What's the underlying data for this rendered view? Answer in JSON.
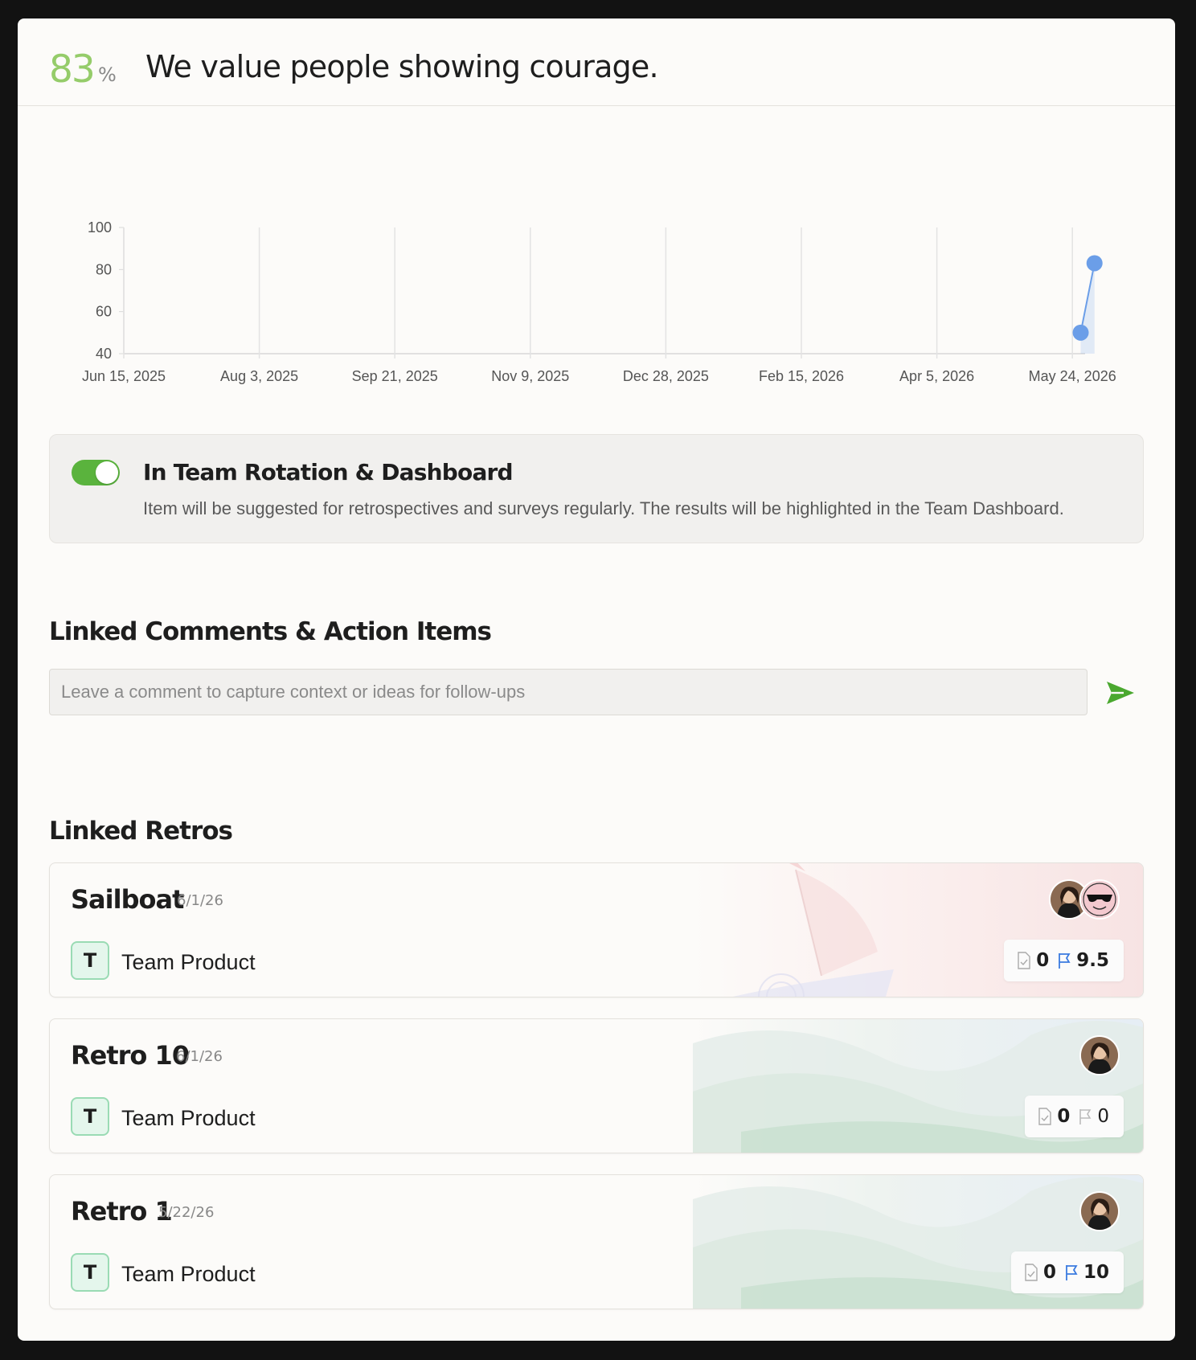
{
  "header": {
    "score": "83",
    "score_unit": "%",
    "title": "We value people showing courage."
  },
  "chart_data": {
    "type": "line",
    "x": [
      "2026-05-27",
      "2026-06-01"
    ],
    "values": [
      50,
      83
    ],
    "xticks": [
      "Jun 15, 2025",
      "Aug 3, 2025",
      "Sep 21, 2025",
      "Nov 9, 2025",
      "Dec 28, 2025",
      "Feb 15, 2026",
      "Apr 5, 2026",
      "May 24, 2026"
    ],
    "yticks": [
      "100",
      "80",
      "60",
      "40"
    ],
    "ylim": [
      40,
      100
    ],
    "xlim": [
      "2025-06-15",
      "2026-06-01"
    ],
    "grid": "vertical",
    "color": "#6b9ee8"
  },
  "rotation": {
    "enabled": true,
    "title": "In Team Rotation & Dashboard",
    "description": "Item will be suggested for retrospectives and surveys regularly. The results will be highlighted in the Team Dashboard."
  },
  "comments": {
    "heading": "Linked Comments & Action Items",
    "placeholder": "Leave a comment to capture context or ideas for follow-ups",
    "send_icon": "send-icon"
  },
  "retros_heading": "Linked Retros",
  "retros": [
    {
      "name": "Sailboat",
      "date": "6/1/26",
      "team_initial": "T",
      "team": "Team Product",
      "notes": "0",
      "actions": "9.5",
      "actions_active": true
    },
    {
      "name": "Retro 10",
      "date": "6/1/26",
      "team_initial": "T",
      "team": "Team Product",
      "notes": "0",
      "actions": "0",
      "actions_active": false
    },
    {
      "name": "Retro 1",
      "date": "5/22/26",
      "team_initial": "T",
      "team": "Team Product",
      "notes": "0",
      "actions": "10",
      "actions_active": true
    }
  ],
  "colors": {
    "score": "#95cc6a",
    "toggle": "#5ab33d",
    "send": "#4aa82f",
    "line": "#6b9ee8",
    "flag_active": "#3b7be0"
  }
}
